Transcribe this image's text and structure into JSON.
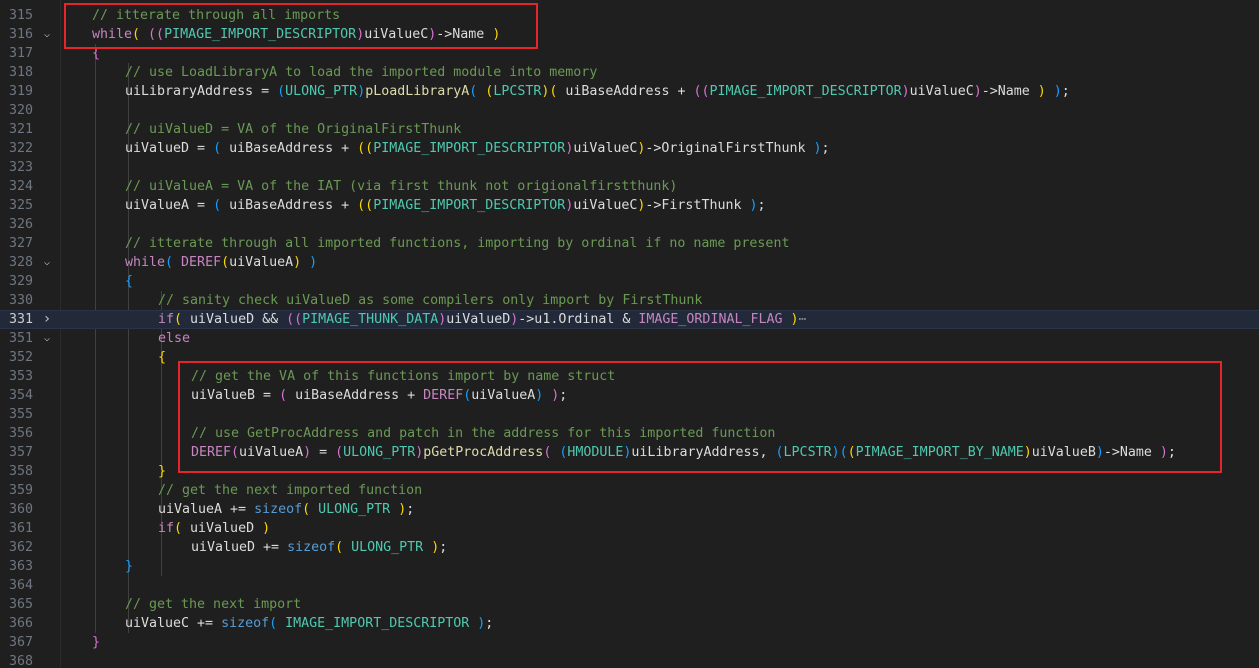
{
  "editor": {
    "lines": [
      {
        "n": "315",
        "fold": "",
        "tokens": [
          [
            "c",
            "// itterate through all imports"
          ]
        ],
        "indent": 1
      },
      {
        "n": "316",
        "fold": "v",
        "tokens": [
          [
            "k",
            "while"
          ],
          [
            "p1",
            "( "
          ],
          [
            "p2",
            "(("
          ],
          [
            "t",
            "PIMAGE_IMPORT_DESCRIPTOR"
          ],
          [
            "p2",
            ")"
          ],
          [
            "v",
            "uiValueC"
          ],
          [
            "p2",
            ")"
          ],
          [
            "v",
            "->Name "
          ],
          [
            "p1",
            ")"
          ]
        ],
        "indent": 1
      },
      {
        "n": "317",
        "fold": "",
        "tokens": [
          [
            "p2",
            "{"
          ]
        ],
        "indent": 1
      },
      {
        "n": "318",
        "fold": "",
        "tokens": [
          [
            "c",
            "// use LoadLibraryA to load the imported module into memory"
          ]
        ],
        "indent": 2
      },
      {
        "n": "319",
        "fold": "",
        "tokens": [
          [
            "v",
            "uiLibraryAddress = "
          ],
          [
            "p3",
            "("
          ],
          [
            "t",
            "ULONG_PTR"
          ],
          [
            "p3",
            ")"
          ],
          [
            "fn",
            "pLoadLibraryA"
          ],
          [
            "p3",
            "( "
          ],
          [
            "p1",
            "("
          ],
          [
            "t",
            "LPCSTR"
          ],
          [
            "p1",
            ")"
          ],
          [
            "p1",
            "( "
          ],
          [
            "v",
            "uiBaseAddress + "
          ],
          [
            "p2",
            "(("
          ],
          [
            "t",
            "PIMAGE_IMPORT_DESCRIPTOR"
          ],
          [
            "p2",
            ")"
          ],
          [
            "v",
            "uiValueC"
          ],
          [
            "p2",
            ")"
          ],
          [
            "v",
            "->Name "
          ],
          [
            "p1",
            ")"
          ],
          [
            "p3",
            " )"
          ],
          [
            "v",
            ";"
          ]
        ],
        "indent": 2
      },
      {
        "n": "320",
        "fold": "",
        "tokens": [],
        "indent": 2
      },
      {
        "n": "321",
        "fold": "",
        "tokens": [
          [
            "c",
            "// uiValueD = VA of the OriginalFirstThunk"
          ]
        ],
        "indent": 2
      },
      {
        "n": "322",
        "fold": "",
        "tokens": [
          [
            "v",
            "uiValueD = "
          ],
          [
            "p3",
            "( "
          ],
          [
            "v",
            "uiBaseAddress + "
          ],
          [
            "p1",
            "(("
          ],
          [
            "t",
            "PIMAGE_IMPORT_DESCRIPTOR"
          ],
          [
            "p2",
            ")"
          ],
          [
            "v",
            "uiValueC"
          ],
          [
            "p1",
            ")"
          ],
          [
            "v",
            "->OriginalFirstThunk "
          ],
          [
            "p3",
            ")"
          ],
          [
            "v",
            ";"
          ]
        ],
        "indent": 2
      },
      {
        "n": "323",
        "fold": "",
        "tokens": [],
        "indent": 2
      },
      {
        "n": "324",
        "fold": "",
        "tokens": [
          [
            "c",
            "// uiValueA = VA of the IAT (via first thunk not origionalfirstthunk)"
          ]
        ],
        "indent": 2
      },
      {
        "n": "325",
        "fold": "",
        "tokens": [
          [
            "v",
            "uiValueA = "
          ],
          [
            "p3",
            "( "
          ],
          [
            "v",
            "uiBaseAddress + "
          ],
          [
            "p1",
            "(("
          ],
          [
            "t",
            "PIMAGE_IMPORT_DESCRIPTOR"
          ],
          [
            "p2",
            ")"
          ],
          [
            "v",
            "uiValueC"
          ],
          [
            "p1",
            ")"
          ],
          [
            "v",
            "->FirstThunk "
          ],
          [
            "p3",
            ")"
          ],
          [
            "v",
            ";"
          ]
        ],
        "indent": 2
      },
      {
        "n": "326",
        "fold": "",
        "tokens": [],
        "indent": 2
      },
      {
        "n": "327",
        "fold": "",
        "tokens": [
          [
            "c",
            "// itterate through all imported functions, importing by ordinal if no name present"
          ]
        ],
        "indent": 2
      },
      {
        "n": "328",
        "fold": "v",
        "tokens": [
          [
            "k",
            "while"
          ],
          [
            "p3",
            "( "
          ],
          [
            "m",
            "DEREF"
          ],
          [
            "p1",
            "("
          ],
          [
            "v",
            "uiValueA"
          ],
          [
            "p1",
            ")"
          ],
          [
            "p3",
            " )"
          ]
        ],
        "indent": 2
      },
      {
        "n": "329",
        "fold": "",
        "tokens": [
          [
            "p3",
            "{"
          ]
        ],
        "indent": 2
      },
      {
        "n": "330",
        "fold": "",
        "tokens": [
          [
            "c",
            "// sanity check uiValueD as some compilers only import by FirstThunk"
          ]
        ],
        "indent": 3
      },
      {
        "n": "331",
        "fold": ">",
        "tokens": [
          [
            "k",
            "if"
          ],
          [
            "p1",
            "( "
          ],
          [
            "v",
            "uiValueD && "
          ],
          [
            "p2",
            "(("
          ],
          [
            "t",
            "PIMAGE_THUNK_DATA"
          ],
          [
            "p2",
            ")"
          ],
          [
            "v",
            "uiValueD"
          ],
          [
            "p2",
            ")"
          ],
          [
            "v",
            "->u1.Ordinal & "
          ],
          [
            "m",
            "IMAGE_ORDINAL_FLAG"
          ],
          [
            "p1",
            " )"
          ],
          [
            "el",
            "⋯"
          ]
        ],
        "indent": 3,
        "current": true
      },
      {
        "n": "351",
        "fold": "v",
        "tokens": [
          [
            "k",
            "else"
          ]
        ],
        "indent": 3
      },
      {
        "n": "352",
        "fold": "",
        "tokens": [
          [
            "p1",
            "{"
          ]
        ],
        "indent": 3
      },
      {
        "n": "353",
        "fold": "",
        "tokens": [
          [
            "c",
            "// get the VA of this functions import by name struct"
          ]
        ],
        "indent": 4
      },
      {
        "n": "354",
        "fold": "",
        "tokens": [
          [
            "v",
            "uiValueB = "
          ],
          [
            "p2",
            "( "
          ],
          [
            "v",
            "uiBaseAddress + "
          ],
          [
            "m",
            "DEREF"
          ],
          [
            "p3",
            "("
          ],
          [
            "v",
            "uiValueA"
          ],
          [
            "p3",
            ")"
          ],
          [
            "p2",
            " )"
          ],
          [
            "v",
            ";"
          ]
        ],
        "indent": 4
      },
      {
        "n": "355",
        "fold": "",
        "tokens": [],
        "indent": 4
      },
      {
        "n": "356",
        "fold": "",
        "tokens": [
          [
            "c",
            "// use GetProcAddress and patch in the address for this imported function"
          ]
        ],
        "indent": 4
      },
      {
        "n": "357",
        "fold": "",
        "tokens": [
          [
            "m",
            "DEREF"
          ],
          [
            "p2",
            "("
          ],
          [
            "v",
            "uiValueA"
          ],
          [
            "p2",
            ")"
          ],
          [
            "v",
            " = "
          ],
          [
            "p2",
            "("
          ],
          [
            "t",
            "ULONG_PTR"
          ],
          [
            "p2",
            ")"
          ],
          [
            "fn",
            "pGetProcAddress"
          ],
          [
            "p2",
            "( "
          ],
          [
            "p3",
            "("
          ],
          [
            "t",
            "HMODULE"
          ],
          [
            "p3",
            ")"
          ],
          [
            "v",
            "uiLibraryAddress, "
          ],
          [
            "p3",
            "("
          ],
          [
            "t",
            "LPCSTR"
          ],
          [
            "p3",
            ")"
          ],
          [
            "p3",
            "("
          ],
          [
            "p1",
            "("
          ],
          [
            "t",
            "PIMAGE_IMPORT_BY_NAME"
          ],
          [
            "p1",
            ")"
          ],
          [
            "v",
            "uiValueB"
          ],
          [
            "p3",
            ")"
          ],
          [
            "v",
            "->Name "
          ],
          [
            "p2",
            ")"
          ],
          [
            "v",
            ";"
          ]
        ],
        "indent": 4
      },
      {
        "n": "358",
        "fold": "",
        "tokens": [
          [
            "p1",
            "}"
          ]
        ],
        "indent": 3
      },
      {
        "n": "359",
        "fold": "",
        "tokens": [
          [
            "c",
            "// get the next imported function"
          ]
        ],
        "indent": 3
      },
      {
        "n": "360",
        "fold": "",
        "tokens": [
          [
            "v",
            "uiValueA += "
          ],
          [
            "kb",
            "sizeof"
          ],
          [
            "p1",
            "( "
          ],
          [
            "t",
            "ULONG_PTR"
          ],
          [
            "p1",
            " )"
          ],
          [
            "v",
            ";"
          ]
        ],
        "indent": 3
      },
      {
        "n": "361",
        "fold": "",
        "tokens": [
          [
            "k",
            "if"
          ],
          [
            "p1",
            "( "
          ],
          [
            "v",
            "uiValueD "
          ],
          [
            "p1",
            ")"
          ]
        ],
        "indent": 3
      },
      {
        "n": "362",
        "fold": "",
        "tokens": [
          [
            "v",
            "uiValueD += "
          ],
          [
            "kb",
            "sizeof"
          ],
          [
            "p1",
            "( "
          ],
          [
            "t",
            "ULONG_PTR"
          ],
          [
            "p1",
            " )"
          ],
          [
            "v",
            ";"
          ]
        ],
        "indent": 4
      },
      {
        "n": "363",
        "fold": "",
        "tokens": [
          [
            "p3",
            "}"
          ]
        ],
        "indent": 2
      },
      {
        "n": "364",
        "fold": "",
        "tokens": [],
        "indent": 2
      },
      {
        "n": "365",
        "fold": "",
        "tokens": [
          [
            "c",
            "// get the next import"
          ]
        ],
        "indent": 2
      },
      {
        "n": "366",
        "fold": "",
        "tokens": [
          [
            "v",
            "uiValueC += "
          ],
          [
            "kb",
            "sizeof"
          ],
          [
            "p3",
            "( "
          ],
          [
            "t",
            "IMAGE_IMPORT_DESCRIPTOR"
          ],
          [
            "p3",
            " )"
          ],
          [
            "v",
            ";"
          ]
        ],
        "indent": 2
      },
      {
        "n": "367",
        "fold": "",
        "tokens": [
          [
            "p2",
            "}"
          ]
        ],
        "indent": 1
      },
      {
        "n": "368",
        "fold": "",
        "tokens": [],
        "indent": 1
      }
    ],
    "fold_icons": {
      "v": "chevron-down-icon",
      "&gt;": "chevron-right-icon"
    },
    "colors": {
      "background": "#1f1f1f",
      "comment": "#6a9955",
      "keyword": "#c586c0",
      "type": "#4ec9b0",
      "highlight_box": "#e5252a"
    }
  }
}
